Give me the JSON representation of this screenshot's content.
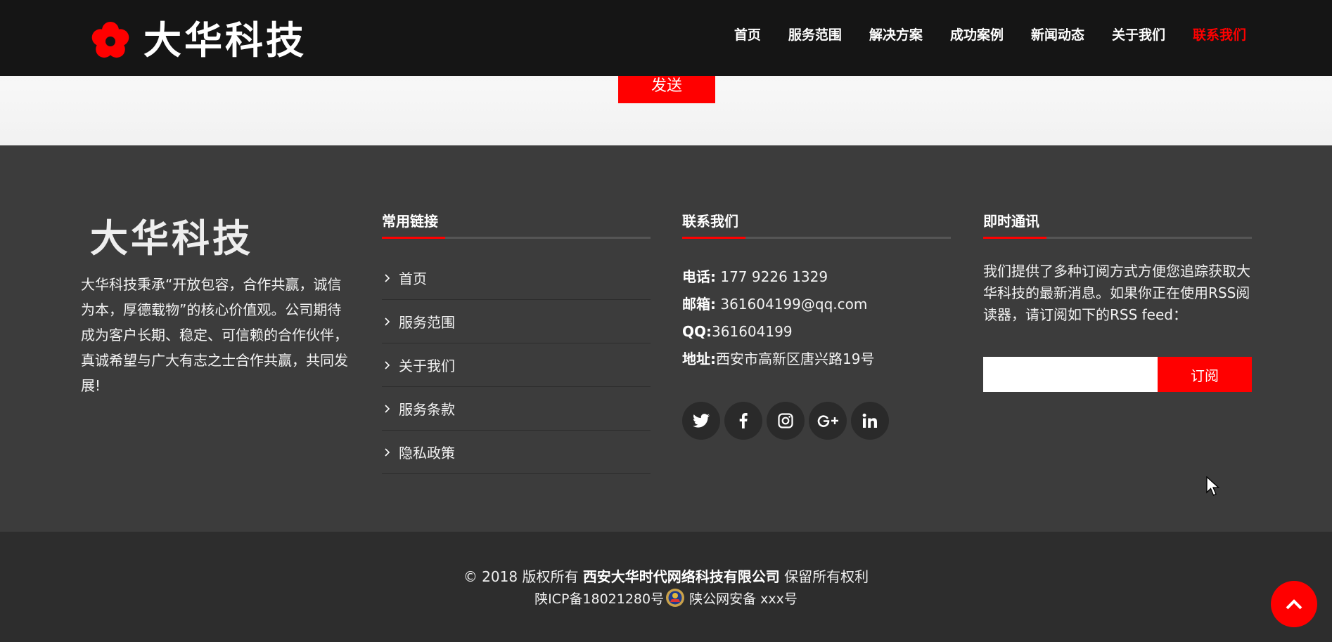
{
  "header": {
    "logo_text": "大华科技",
    "nav": [
      "首页",
      "服务范围",
      "解决方案",
      "成功案例",
      "新闻动态",
      "关于我们",
      "联系我们"
    ],
    "active_nav": "联系我们"
  },
  "form": {
    "send_label": "发送"
  },
  "footer": {
    "brand_title": "大华科技",
    "brand_desc": "大华科技秉承“开放包容，合作共赢，诚信为本，厚德载物”的核心价值观。公司期待成为客户长期、稳定、可信赖的合作伙伴，真诚希望与广大有志之士合作共赢，共同发展!",
    "links_title": "常用链接",
    "links": [
      "首页",
      "服务范围",
      "关于我们",
      "服务条款",
      "隐私政策"
    ],
    "contact_title": "联系我们",
    "contact": {
      "phone_label": "电话:",
      "phone": " 177 9226 1329",
      "email_label": "邮箱:",
      "email": " 361604199@qq.com",
      "qq_label": "QQ:",
      "qq": "361604199",
      "address_label": "地址:",
      "address": "西安市高新区唐兴路19号"
    },
    "socials": [
      "twitter-icon",
      "facebook-icon",
      "instagram-icon",
      "google-plus-icon",
      "linkedin-icon"
    ],
    "subscribe_title": "即时通讯",
    "subscribe_desc": "我们提供了多种订阅方式方便您追踪获取大华科技的最新消息。如果你正在使用RSS阅读器，请订阅如下的RSS feed：",
    "subscribe_placeholder": "",
    "subscribe_button": "订阅"
  },
  "copyright": {
    "prefix": "© 2018 版权所有 ",
    "company": "西安大华时代网络科技有限公司",
    "suffix": " 保留所有权利",
    "icp": "陕ICP备18021280号",
    "police": "陕公网安备 xxx号"
  },
  "colors": {
    "accent": "#ff0000",
    "header_bg": "#151515",
    "footer_bg": "#3c3c3c",
    "copyright_bg": "#2d2d2d"
  }
}
